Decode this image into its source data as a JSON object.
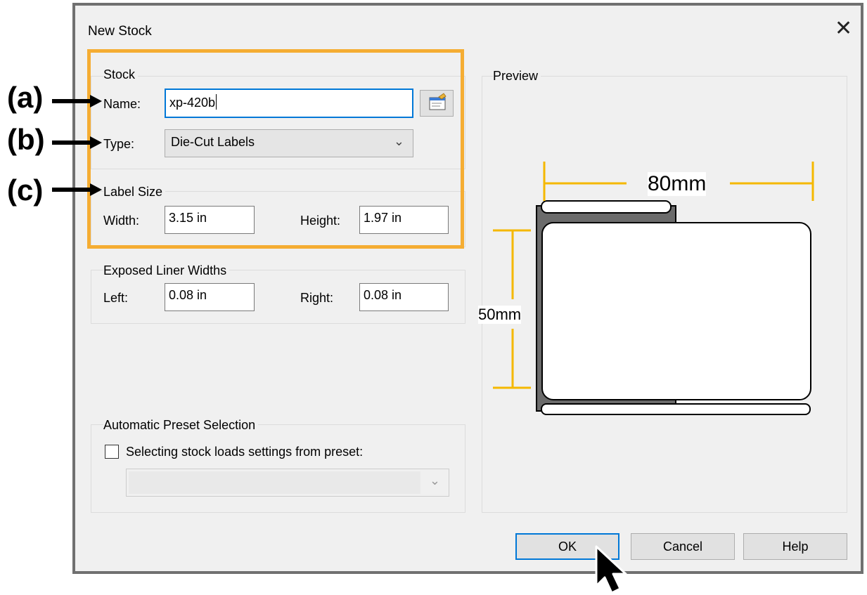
{
  "window": {
    "title": "New Stock",
    "close_glyph": "✕"
  },
  "stock": {
    "legend": "Stock",
    "name_label": "Name:",
    "name_value": "xp-420b",
    "type_label": "Type:",
    "type_value": "Die-Cut Labels",
    "browse_icon": "browse-stock-icon"
  },
  "label_size": {
    "legend": "Label Size",
    "width_label": "Width:",
    "width_value": "3.15 in",
    "height_label": "Height:",
    "height_value": "1.97 in"
  },
  "liner": {
    "legend": "Exposed Liner Widths",
    "left_label": "Left:",
    "left_value": "0.08 in",
    "right_label": "Right:",
    "right_value": "0.08 in"
  },
  "preset": {
    "legend": "Automatic Preset Selection",
    "checkbox_label": "Selecting stock loads settings from preset:",
    "checked": false,
    "selected": ""
  },
  "preview": {
    "legend": "Preview",
    "width_dim": "80mm",
    "height_dim": "50mm"
  },
  "buttons": {
    "ok": "OK",
    "cancel": "Cancel",
    "help": "Help"
  },
  "annotations": {
    "a": "(a)",
    "b": "(b)",
    "c": "(c)"
  },
  "colors": {
    "highlight": "#f5ad33",
    "accent": "#0078d7",
    "dimension": "#f5b800"
  }
}
